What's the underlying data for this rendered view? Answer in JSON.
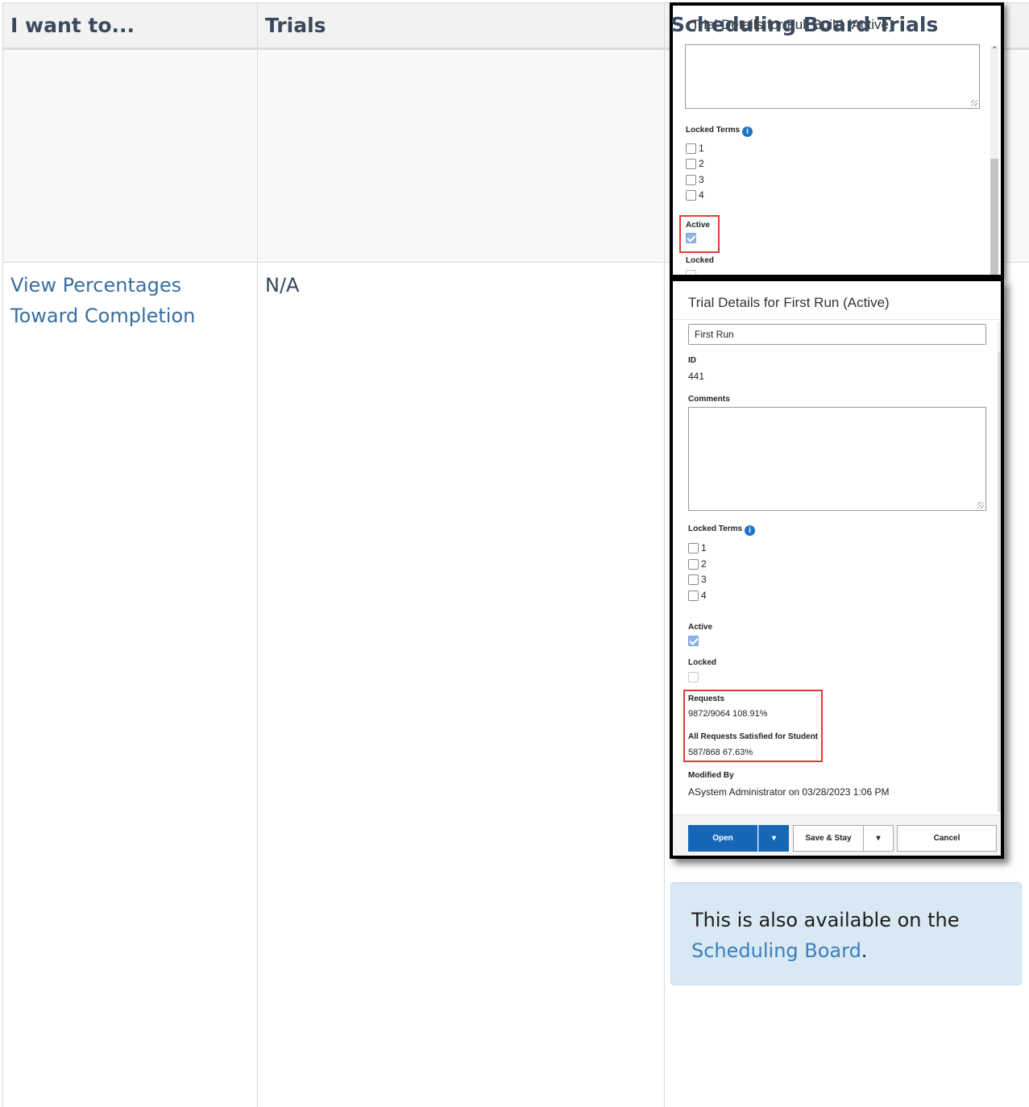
{
  "table": {
    "headers": [
      "I want to...",
      "Trials",
      "Scheduling Board Trials"
    ],
    "row2": {
      "task": "View Percentages Toward Completion",
      "trials": "N/A"
    }
  },
  "overlay_title": "Trial Details for Full Build (Active)",
  "top_shot": {
    "locked_terms_label": "Locked Terms",
    "terms": [
      "1",
      "2",
      "3",
      "4"
    ],
    "active_label": "Active",
    "locked_label": "Locked"
  },
  "main_shot": {
    "title": "Trial Details for First Run (Active)",
    "name_value": "First Run",
    "id_label": "ID",
    "id_value": "441",
    "comments_label": "Comments",
    "locked_terms_label": "Locked Terms",
    "terms": [
      "1",
      "2",
      "3",
      "4"
    ],
    "active_label": "Active",
    "locked_label": "Locked",
    "requests_label": "Requests",
    "requests_value": "9872/9064 108.91%",
    "all_requests_label": "All Requests Satisfied for Student",
    "all_requests_value": "587/868 67.63%",
    "modified_by_label": "Modified By",
    "modified_by_value": "ASystem Administrator on 03/28/2023 1:06 PM",
    "buttons": {
      "open": "Open",
      "save_stay": "Save & Stay",
      "cancel": "Cancel"
    }
  },
  "note": {
    "text_before": "This is also available on the ",
    "link": "Scheduling Board",
    "text_after": "."
  },
  "colors": {
    "accent_blue": "#1666b8",
    "highlight_red": "#e53935",
    "note_bg": "#d9e9f3",
    "link": "#3a7fbe"
  },
  "icons": [
    "info-icon",
    "checkbox-icon",
    "dropdown-caret-icon",
    "scroll-up-icon",
    "resize-handle-icon"
  ]
}
